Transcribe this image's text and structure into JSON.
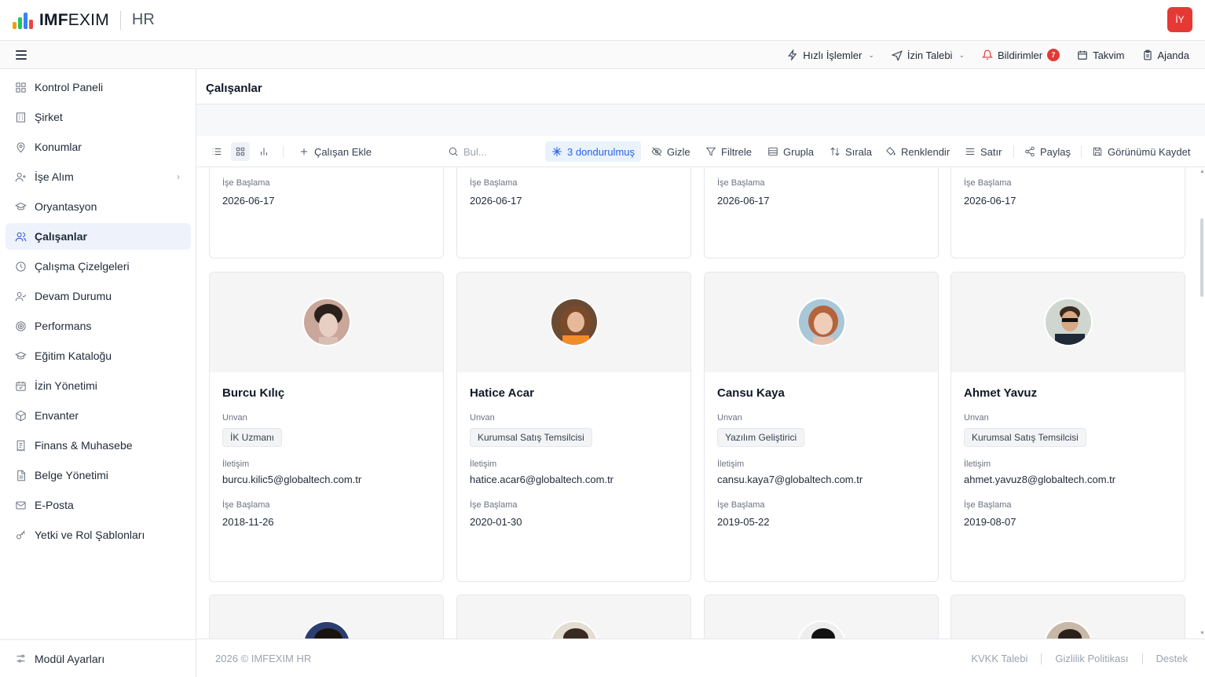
{
  "app": {
    "brand_bold": "IMF",
    "brand_rest": "EXIM",
    "module": "HR",
    "user_initials": "İY"
  },
  "logo_colors": [
    "#f59e0b",
    "#22c55e",
    "#3b82f6",
    "#ef4444"
  ],
  "subbar": {
    "quick_actions": "Hızlı İşlemler",
    "leave_request": "İzin Talebi",
    "notifications": "Bildirimler",
    "notification_count": "7",
    "calendar": "Takvim",
    "agenda": "Ajanda"
  },
  "sidebar": {
    "items": [
      {
        "label": "Kontrol Paneli",
        "icon": "dashboard-icon"
      },
      {
        "label": "Şirket",
        "icon": "building-icon"
      },
      {
        "label": "Konumlar",
        "icon": "map-pin-icon"
      },
      {
        "label": "İşe Alım",
        "icon": "user-plus-icon"
      },
      {
        "label": "Oryantasyon",
        "icon": "graduation-cap-icon"
      },
      {
        "label": "Çalışanlar",
        "icon": "users-icon"
      },
      {
        "label": "Çalışma Çizelgeleri",
        "icon": "clock-icon"
      },
      {
        "label": "Devam Durumu",
        "icon": "user-check-icon"
      },
      {
        "label": "Performans",
        "icon": "target-icon"
      },
      {
        "label": "Eğitim Kataloğu",
        "icon": "graduation-cap-icon"
      },
      {
        "label": "İzin Yönetimi",
        "icon": "calendar-check-icon"
      },
      {
        "label": "Envanter",
        "icon": "package-icon"
      },
      {
        "label": "Finans & Muhasebe",
        "icon": "receipt-icon"
      },
      {
        "label": "Belge Yönetimi",
        "icon": "file-icon"
      },
      {
        "label": "E-Posta",
        "icon": "mail-icon"
      },
      {
        "label": "Yetki ve Rol Şablonları",
        "icon": "key-icon"
      }
    ],
    "active_index": 5,
    "footer": "Modül Ayarları"
  },
  "page": {
    "title": "Çalışanlar"
  },
  "toolbar": {
    "add_employee": "Çalışan Ekle",
    "search_placeholder": "Bul...",
    "frozen": "3 dondurulmuş",
    "hide": "Gizle",
    "filter": "Filtrele",
    "group": "Grupla",
    "sort": "Sırala",
    "colorize": "Renklendir",
    "row": "Satır",
    "share": "Paylaş",
    "save_view": "Görünümü Kaydet"
  },
  "labels": {
    "title": "Unvan",
    "contact": "İletişim",
    "start_date": "İşe Başlama"
  },
  "partial_top_cards": [
    {
      "start_date": "2026-06-17"
    },
    {
      "start_date": "2026-06-17"
    },
    {
      "start_date": "2026-06-17"
    },
    {
      "start_date": "2026-06-17"
    }
  ],
  "employees": [
    {
      "name": "Burcu Kılıç",
      "title": "İK Uzmanı",
      "email": "burcu.kilic5@globaltech.com.tr",
      "start_date": "2018-11-26"
    },
    {
      "name": "Hatice Acar",
      "title": "Kurumsal Satış Temsilcisi",
      "email": "hatice.acar6@globaltech.com.tr",
      "start_date": "2020-01-30"
    },
    {
      "name": "Cansu Kaya",
      "title": "Yazılım Geliştirici",
      "email": "cansu.kaya7@globaltech.com.tr",
      "start_date": "2019-05-22"
    },
    {
      "name": "Ahmet Yavuz",
      "title": "Kurumsal Satış Temsilcisi",
      "email": "ahmet.yavuz8@globaltech.com.tr",
      "start_date": "2019-08-07"
    }
  ],
  "footer": {
    "copyright": "2026 © IMFEXIM HR",
    "links": [
      "KVKK Talebi",
      "Gizlilik Politikası",
      "Destek"
    ]
  }
}
